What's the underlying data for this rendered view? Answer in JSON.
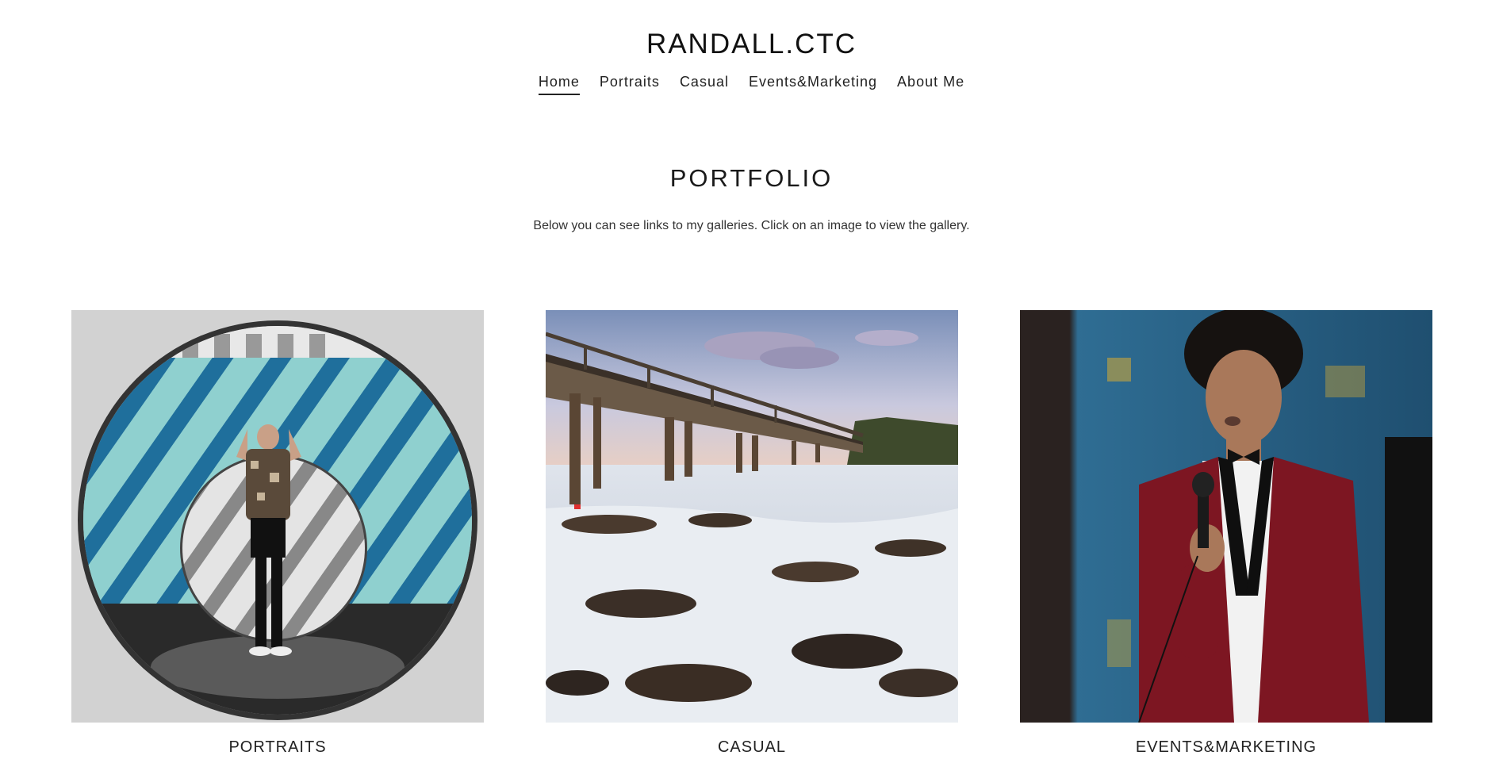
{
  "header": {
    "site_title": "RANDALL.CTC"
  },
  "nav": {
    "items": [
      {
        "label": "Home",
        "active": true
      },
      {
        "label": "Portraits",
        "active": false
      },
      {
        "label": "Casual",
        "active": false
      },
      {
        "label": "Events&Marketing",
        "active": false
      },
      {
        "label": "About Me",
        "active": false
      }
    ]
  },
  "main": {
    "title": "PORTFOLIO",
    "description": "Below you can see links to my galleries. Click on an image to view the gallery."
  },
  "gallery": {
    "cards": [
      {
        "label": "PORTRAITS",
        "image": "portrait-in-circular-wall-photo"
      },
      {
        "label": "CASUAL",
        "image": "pier-over-rocky-sea-photo"
      },
      {
        "label": "EVENTS&MARKETING",
        "image": "man-with-microphone-red-jacket-photo"
      }
    ]
  },
  "colors": {
    "text": "#1a1a1a",
    "background": "#ffffff",
    "accent_red": "#8a1420",
    "accent_teal": "#7cc4c8",
    "accent_blue": "#2b7fb8"
  }
}
